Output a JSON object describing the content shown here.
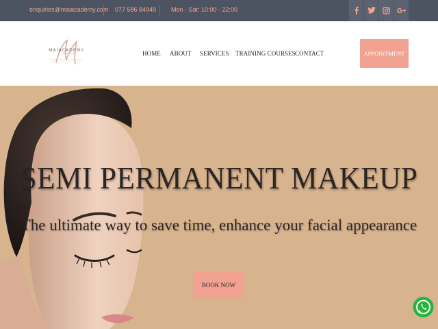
{
  "topbar": {
    "email": "enquiries@maiacademy.com",
    "phone": "077 586 84949",
    "hours": "Mon - Sat: 10:00 - 22:00",
    "social_icons": [
      "facebook-icon",
      "twitter-icon",
      "instagram-icon",
      "google-plus-icon"
    ]
  },
  "header": {
    "logo_text": "MAIACADEMY",
    "nav": [
      "HOME",
      "ABOUT",
      "SERVICES",
      "TRAINING COURSES",
      "CONTACT"
    ],
    "appointment_label": "APPOINTMENT"
  },
  "hero": {
    "title": "SEMI PERMANENT MAKEUP",
    "subtitle": "The ultimate way to save time, enhance your facial appearance",
    "book_label": "BOOK NOW"
  },
  "floating": {
    "icon": "whatsapp-icon"
  },
  "colors": {
    "topbar_bg": "#4c5461",
    "topbar_text": "#f0a68f",
    "accent": "#f1a291",
    "hero_bg": "#d7b38e",
    "text_dark": "#2b2523",
    "whatsapp": "#27b43e"
  }
}
